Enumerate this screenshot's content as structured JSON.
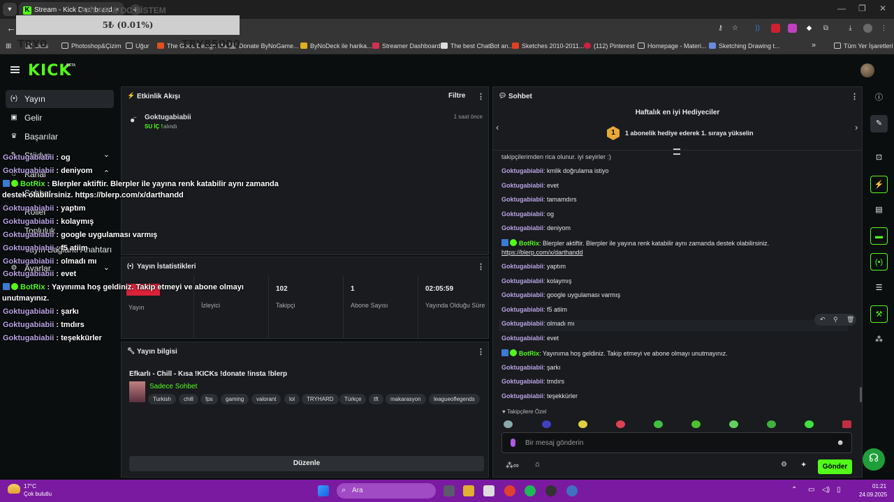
{
  "browser": {
    "tab_title": "Stream - Kick Dashboard",
    "tab_close": "×",
    "new_tab": "+",
    "bookmarks": [
      "Litas",
      "Photoshop&Çizim",
      "Uğur",
      "The Good Design Ma...",
      "Donate ByNoGame...",
      "ByNoDeck ile harika...",
      "Streamer Dashboard",
      "The best ChatBot an...",
      "Sketches 2010-2011...",
      "(112) Pinterest",
      "Homepage - Materi...",
      "Sketching Drawing t..."
    ],
    "all_bookmarks": "Tüm Yer İşaretleri",
    "more": "»"
  },
  "overlay": {
    "widget_text": "5₺ (0.01%)",
    "ghost_title": "ANLAR & DC SİSTEM",
    "ghost_left": "TRY0",
    "ghost_right": "TRY85000"
  },
  "kick": {
    "logo": "KICK",
    "beta": "BETA"
  },
  "sidebar": {
    "items": [
      {
        "label": "Yayın",
        "icon": "(•)"
      },
      {
        "label": "Gelir",
        "icon": "▣"
      },
      {
        "label": "Başarılar",
        "icon": "♛"
      },
      {
        "label": "Stüdyo",
        "icon": "✎"
      },
      {
        "label": "Kanal",
        "icon": "⌂"
      },
      {
        "label": "Sohbet",
        "icon": "▤"
      },
      {
        "label": "Roller",
        "icon": "♙"
      },
      {
        "label": "Topluluk",
        "icon": "⚑"
      },
      {
        "label": "Yayın Bağlantı Anahtarı",
        "icon": "⚿"
      },
      {
        "label": "Ayarlar",
        "icon": "⚙"
      }
    ],
    "chev_down": "⌄",
    "chev_up": "⌃"
  },
  "chat_overlay": {
    "lines": [
      {
        "user": "Goktugabiabii",
        "sep": " : ",
        "text": "og"
      },
      {
        "user": "Goktugabiabii",
        "sep": " : ",
        "text": "deniyom"
      },
      {
        "user": "BotRix",
        "sep": " : ",
        "text": "Blerpler aktiftir. Blerpler ile yayına renk katabilir aynı zamanda",
        "bot": true
      },
      {
        "text": "destek olabilirsiniz. https://blerp.com/x/darthandd"
      },
      {
        "user": "Goktugabiabii",
        "sep": " : ",
        "text": "yaptım"
      },
      {
        "user": "Goktugabiabii",
        "sep": " : ",
        "text": "kolaymış"
      },
      {
        "user": "Goktugabiabii",
        "sep": " : ",
        "text": "google uygulaması varmış"
      },
      {
        "user": "Goktugabiabii",
        "sep": " : ",
        "text": "f5 atiim"
      },
      {
        "user": "Goktugabiabii",
        "sep": " : ",
        "text": "olmadı mı"
      },
      {
        "user": "Goktugabiabii",
        "sep": " : ",
        "text": "evet"
      },
      {
        "user": "BotRix",
        "sep": " : ",
        "text": "Yayınıma hoş geldiniz. Takip etmeyi ve abone olmayı",
        "bot": true
      },
      {
        "text": "unutmayınız."
      },
      {
        "user": "Goktugabiabii",
        "sep": " : ",
        "text": "şarkı"
      },
      {
        "user": "Goktugabiabii",
        "sep": " : ",
        "text": "tmdırs"
      },
      {
        "user": "Goktugabiabii",
        "sep": " : ",
        "text": "teşekkürler"
      }
    ]
  },
  "activity": {
    "title": "Etkinlik Akışı",
    "filter": "Filtre",
    "user": "Goktugabiabii",
    "reward": "SU İÇ !",
    "reward_suffix": "alındı",
    "time": "1 saat önce"
  },
  "stats": {
    "title": "Yayın İstatistikleri",
    "cells": [
      {
        "value": "",
        "label": "Yayın"
      },
      {
        "value": "",
        "label": "İzleyici"
      },
      {
        "value": "102",
        "label": "Takipçi"
      },
      {
        "value": "1",
        "label": "Abone Sayısı"
      },
      {
        "value": "02:05:59",
        "label": "Yayında Olduğu Süre"
      }
    ]
  },
  "stream_info": {
    "title": "Yayın bilgisi",
    "stream_title": "Efkarlı - Chill - Kısa !KICKs !donate !insta !blerp",
    "category": "Sadece Sohbet",
    "tags": [
      "Turkish",
      "chill",
      "fps",
      "gaming",
      "valorant",
      "lol",
      "TRYHARD",
      "Türkçe",
      "tft",
      "makarasyon",
      "leagueoflegends"
    ],
    "edit": "Düzenle"
  },
  "chat": {
    "title": "Sohbet",
    "gifters_title": "Haftalık en iyi Hediyeciler",
    "gifter_rank": "1",
    "gifter_text": "1 abonelik hediye ederek 1. sıraya yükselin",
    "messages": [
      {
        "text": "takipçilerimden rica olunur. iyi seyirler :)"
      },
      {
        "user": "Goktugabiabii",
        "text": "kmlik doğrulama istiyo"
      },
      {
        "user": "Goktugabiabii",
        "text": "evet"
      },
      {
        "user": "Goktugabiabii",
        "text": "tamamdırs"
      },
      {
        "user": "Goktugabiabii",
        "text": "og"
      },
      {
        "user": "Goktugabiabii",
        "text": "deniyom"
      },
      {
        "user": "BotRix",
        "text": "Blerpler aktiftir. Blerpler ile yayına renk katabilir aynı zamanda destek olabilirsiniz.",
        "bot": true
      },
      {
        "text": "https://blerp.com/x/darthandd",
        "link": true
      },
      {
        "user": "Goktugabiabii",
        "text": "yaptım"
      },
      {
        "user": "Goktugabiabii",
        "text": "kolaymış"
      },
      {
        "user": "Goktugabiabii",
        "text": "google uygulaması varmış"
      },
      {
        "user": "Goktugabiabii",
        "text": "f5 atiim"
      },
      {
        "user": "Goktugabiabii",
        "text": "olmadı mı"
      },
      {
        "user": "Goktugabiabii",
        "text": "evet"
      },
      {
        "user": "BotRix",
        "text": "Yayınıma hoş geldiniz. Takip etmeyi ve abone olmayı unutmayınız.",
        "bot": true
      },
      {
        "user": "Goktugabiabii",
        "text": "şarkı"
      },
      {
        "user": "Goktugabiabii",
        "text": "tmdırs"
      },
      {
        "user": "Goktugabiabii",
        "text": "teşekkürler"
      }
    ],
    "followers_only": "Takipçilere Özel",
    "placeholder": "Bir mesaj gönderin",
    "send": "Gönder"
  },
  "taskbar": {
    "temp": "17°C",
    "weather": "Çok bulutlu",
    "search": "Ara",
    "time": "01:21",
    "date": "24.09.2025"
  },
  "colors": {
    "kick_green": "#53fc18",
    "username_purple": "#b9a3e3",
    "taskbar_purple": "#7a1aa0"
  }
}
